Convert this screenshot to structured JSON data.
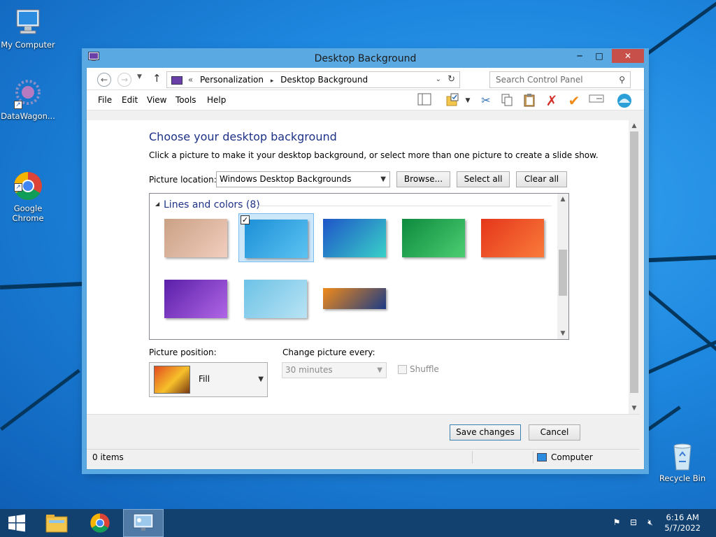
{
  "desktop": {
    "icons": [
      {
        "label": "My Computer"
      },
      {
        "label": "DataWagon..."
      },
      {
        "label": "Google\nChrome"
      },
      {
        "label": "Recycle Bin"
      }
    ]
  },
  "window": {
    "title": "Desktop Background",
    "controls": {
      "minimize": "─",
      "maximize": "□",
      "close": "✕"
    },
    "address": {
      "prefix": "«",
      "crumbs": [
        "Personalization",
        "Desktop Background"
      ],
      "separator": "▸"
    },
    "search": {
      "placeholder": "Search Control Panel"
    },
    "menu": [
      "File",
      "Edit",
      "View",
      "Tools",
      "Help"
    ],
    "heading": "Choose your desktop background",
    "description": "Click a picture to make it your desktop background, or select more than one picture to create a slide show.",
    "picture_location": {
      "label": "Picture location:",
      "value": "Windows Desktop Backgrounds"
    },
    "buttons": {
      "browse": "Browse...",
      "select_all": "Select all",
      "clear_all": "Clear all"
    },
    "gallery": {
      "group": "Lines and colors (8)",
      "items": [
        {
          "name": "pink-cartoon",
          "selected": false,
          "colors": [
            "#c9a184",
            "#f3cdbf"
          ]
        },
        {
          "name": "blue-lines",
          "selected": true,
          "colors": [
            "#1c8fd6",
            "#5cc3f2"
          ]
        },
        {
          "name": "blue-petals",
          "selected": false,
          "colors": [
            "#1e54c8",
            "#39d1c8"
          ]
        },
        {
          "name": "green-stripes",
          "selected": false,
          "colors": [
            "#0d8a3d",
            "#4ccd72"
          ]
        },
        {
          "name": "orange-red",
          "selected": false,
          "colors": [
            "#e5361b",
            "#f97b3a"
          ]
        },
        {
          "name": "purple-waves",
          "selected": false,
          "colors": [
            "#5a1fa8",
            "#b066e6"
          ]
        },
        {
          "name": "light-blue-curve",
          "selected": false,
          "colors": [
            "#6cc2e6",
            "#b9e3f4"
          ]
        },
        {
          "name": "orange-blue-bars",
          "selected": false,
          "colors": [
            "#f08a18",
            "#1b3b86"
          ]
        }
      ]
    },
    "picture_position": {
      "label": "Picture position:",
      "value": "Fill"
    },
    "change_picture": {
      "label": "Change picture every:",
      "value": "30 minutes"
    },
    "shuffle": {
      "label": "Shuffle",
      "checked": false
    },
    "footer": {
      "save": "Save changes",
      "cancel": "Cancel"
    },
    "status": {
      "items": "0 items",
      "location": "Computer"
    }
  },
  "taskbar": {
    "clock_time": "6:16 AM",
    "clock_date": "5/7/2022"
  }
}
